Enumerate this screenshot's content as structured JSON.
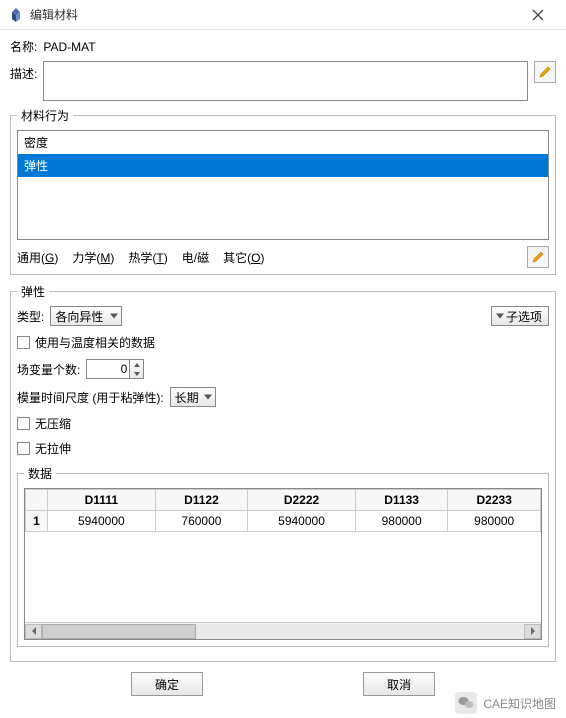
{
  "titlebar": {
    "title": "编辑材料"
  },
  "name": {
    "label": "名称:",
    "value": "PAD-MAT"
  },
  "description": {
    "label": "描述:",
    "value": ""
  },
  "behavior": {
    "legend": "材料行为",
    "items": [
      {
        "label": "密度",
        "selected": false
      },
      {
        "label": "弹性",
        "selected": true
      }
    ],
    "tabs": {
      "general": "通用",
      "general_key": "G",
      "mechanical": "力学",
      "mechanical_key": "M",
      "thermal": "热学",
      "thermal_key": "T",
      "em": "电/磁",
      "other": "其它",
      "other_key": "O"
    }
  },
  "elasticity": {
    "legend": "弹性",
    "type_label": "类型:",
    "type_value": "各向异性",
    "sub_option": "子选项",
    "temp_data": "使用与温度相关的数据",
    "field_var_label": "场变量个数:",
    "field_var_value": "0",
    "moduli_label": "模量时间尺度 (用于粘弹性):",
    "moduli_value": "长期",
    "no_compress": "无压缩",
    "no_tension": "无拉伸"
  },
  "data": {
    "legend": "数据",
    "columns": [
      "D1111",
      "D1122",
      "D2222",
      "D1133",
      "D2233"
    ],
    "row_index": "1",
    "values": [
      "5940000",
      "760000",
      "5940000",
      "980000",
      "980000"
    ]
  },
  "buttons": {
    "ok": "确定",
    "cancel": "取消"
  },
  "watermark": "CAE知识地图"
}
